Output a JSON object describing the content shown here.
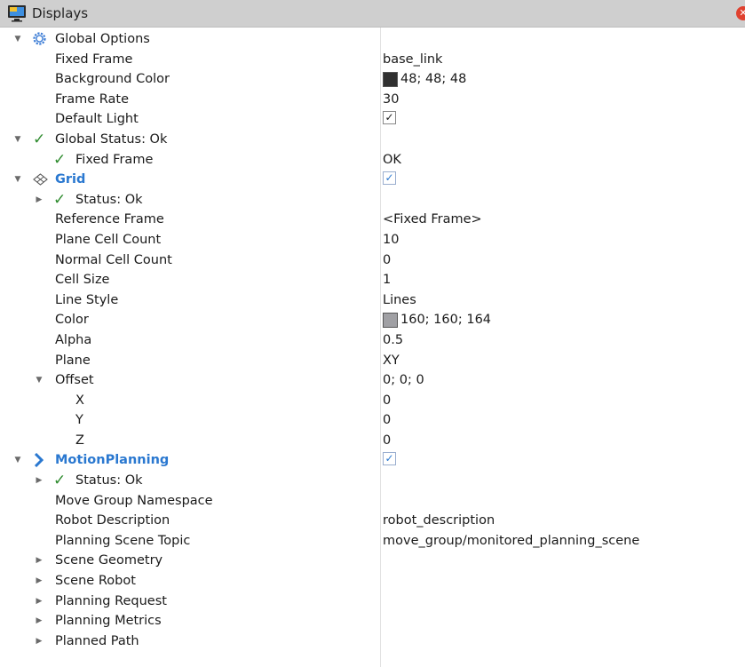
{
  "panel": {
    "title": "Displays"
  },
  "global_options": {
    "label": "Global Options",
    "fixed_frame": {
      "label": "Fixed Frame",
      "value": "base_link"
    },
    "background_color": {
      "label": "Background Color",
      "value": "48; 48; 48",
      "swatch": "#303030"
    },
    "frame_rate": {
      "label": "Frame Rate",
      "value": "30"
    },
    "default_light": {
      "label": "Default Light",
      "checked": true
    }
  },
  "global_status": {
    "label": "Global Status: Ok",
    "fixed_frame": {
      "label": "Fixed Frame",
      "value": "OK"
    }
  },
  "grid": {
    "label": "Grid",
    "checked": true,
    "status": "Status: Ok",
    "reference_frame": {
      "label": "Reference Frame",
      "value": "<Fixed Frame>"
    },
    "plane_cell_count": {
      "label": "Plane Cell Count",
      "value": "10"
    },
    "normal_cell_count": {
      "label": "Normal Cell Count",
      "value": "0"
    },
    "cell_size": {
      "label": "Cell Size",
      "value": "1"
    },
    "line_style": {
      "label": "Line Style",
      "value": "Lines"
    },
    "color": {
      "label": "Color",
      "value": "160; 160; 164",
      "swatch": "#a0a0a4"
    },
    "alpha": {
      "label": "Alpha",
      "value": "0.5"
    },
    "plane": {
      "label": "Plane",
      "value": "XY"
    },
    "offset": {
      "label": "Offset",
      "value": "0; 0; 0",
      "x": {
        "label": "X",
        "value": "0"
      },
      "y": {
        "label": "Y",
        "value": "0"
      },
      "z": {
        "label": "Z",
        "value": "0"
      }
    }
  },
  "motion_planning": {
    "label": "MotionPlanning",
    "checked": true,
    "status": "Status: Ok",
    "move_group_namespace": {
      "label": "Move Group Namespace",
      "value": ""
    },
    "robot_description": {
      "label": "Robot Description",
      "value": "robot_description"
    },
    "planning_scene_topic": {
      "label": "Planning Scene Topic",
      "value": "move_group/monitored_planning_scene"
    },
    "scene_geometry": "Scene Geometry",
    "scene_robot": "Scene Robot",
    "planning_request": "Planning Request",
    "planning_metrics": "Planning Metrics",
    "planned_path": "Planned Path"
  },
  "colors": {
    "accent": "#2a78d0",
    "ok_check": "#2e8b2e",
    "title_bar": "#cfcfcf",
    "close": "#e0412f"
  }
}
